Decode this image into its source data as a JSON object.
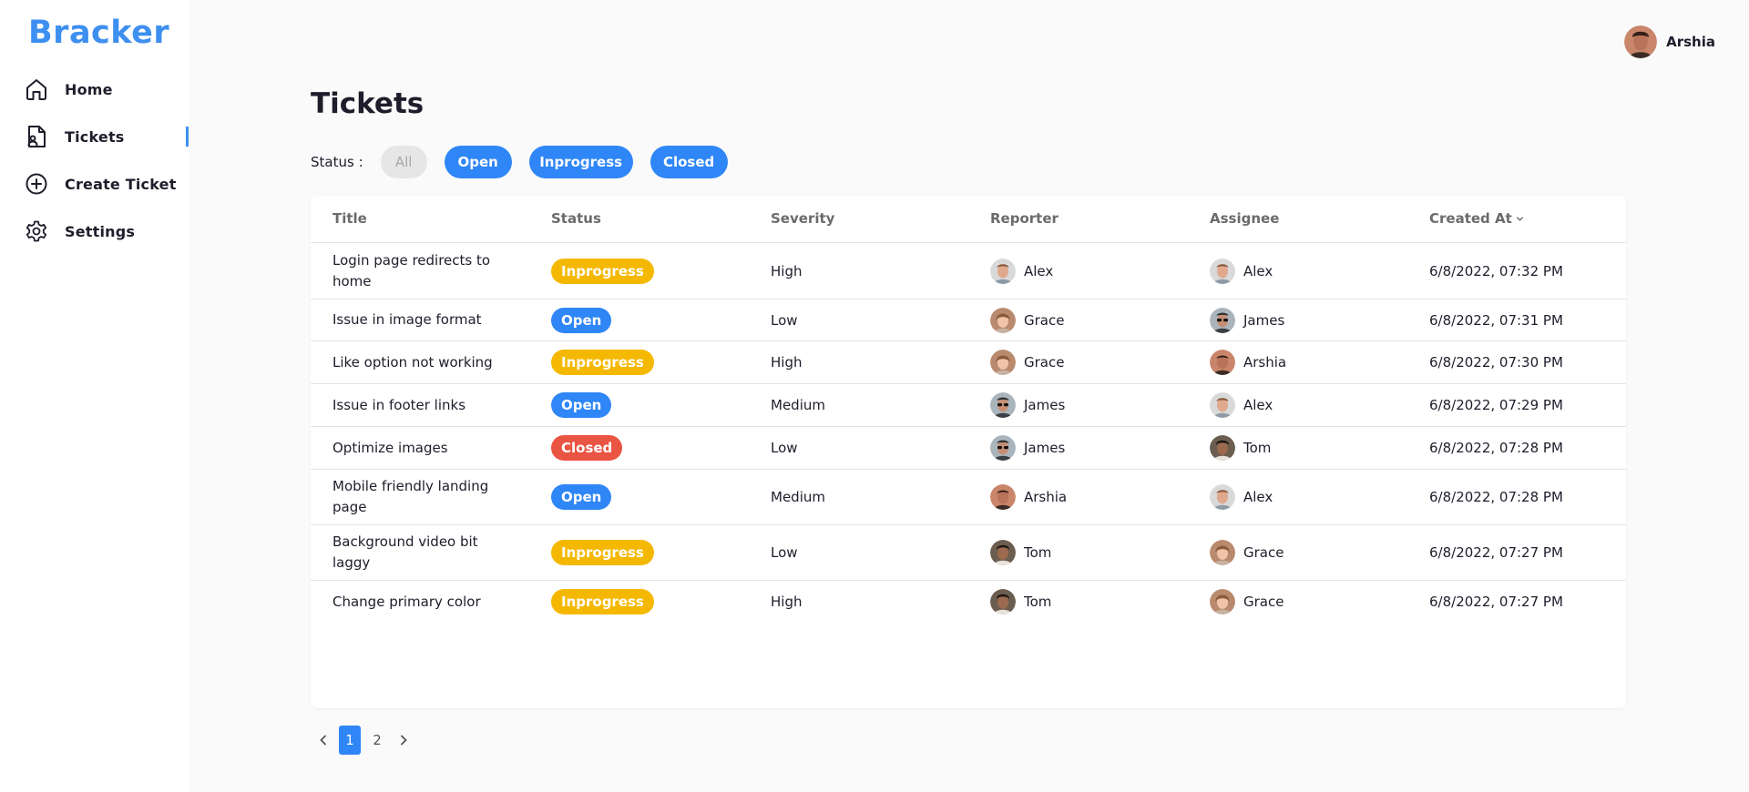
{
  "app": {
    "logo": "Bracker"
  },
  "sidebar": {
    "items": [
      {
        "label": "Home",
        "icon": "home-icon"
      },
      {
        "label": "Tickets",
        "icon": "ticket-document-icon",
        "active": true
      },
      {
        "label": "Create Ticket",
        "icon": "plus-circle-icon"
      },
      {
        "label": "Settings",
        "icon": "gear-icon"
      }
    ]
  },
  "header": {
    "user_name": "Arshia"
  },
  "page": {
    "title": "Tickets"
  },
  "filters": {
    "label": "Status :",
    "options": [
      {
        "label": "All",
        "state": "disabled"
      },
      {
        "label": "Open",
        "state": "selected"
      },
      {
        "label": "Inprogress",
        "state": "selected"
      },
      {
        "label": "Closed",
        "state": "selected"
      }
    ]
  },
  "table": {
    "columns": [
      "Title",
      "Status",
      "Severity",
      "Reporter",
      "Assignee",
      "Created At"
    ],
    "sort_column": "Created At",
    "rows": [
      {
        "title": "Login page redirects to home",
        "status": "Inprogress",
        "severity": "High",
        "reporter": "Alex",
        "assignee": "Alex",
        "created_at": "6/8/2022, 07:32 PM"
      },
      {
        "title": "Issue in image format",
        "status": "Open",
        "severity": "Low",
        "reporter": "Grace",
        "assignee": "James",
        "created_at": "6/8/2022, 07:31 PM"
      },
      {
        "title": "Like option not working",
        "status": "Inprogress",
        "severity": "High",
        "reporter": "Grace",
        "assignee": "Arshia",
        "created_at": "6/8/2022, 07:30 PM"
      },
      {
        "title": "Issue in footer links",
        "status": "Open",
        "severity": "Medium",
        "reporter": "James",
        "assignee": "Alex",
        "created_at": "6/8/2022, 07:29 PM"
      },
      {
        "title": "Optimize images",
        "status": "Closed",
        "severity": "Low",
        "reporter": "James",
        "assignee": "Tom",
        "created_at": "6/8/2022, 07:28 PM"
      },
      {
        "title": "Mobile friendly landing page",
        "status": "Open",
        "severity": "Medium",
        "reporter": "Arshia",
        "assignee": "Alex",
        "created_at": "6/8/2022, 07:28 PM"
      },
      {
        "title": "Background video bit laggy",
        "status": "Inprogress",
        "severity": "Low",
        "reporter": "Tom",
        "assignee": "Grace",
        "created_at": "6/8/2022, 07:27 PM"
      },
      {
        "title": "Change primary color",
        "status": "Inprogress",
        "severity": "High",
        "reporter": "Tom",
        "assignee": "Grace",
        "created_at": "6/8/2022, 07:27 PM"
      }
    ]
  },
  "pagination": {
    "pages": [
      "1",
      "2"
    ],
    "current": "1"
  },
  "colors": {
    "brand": "#3d8ff0",
    "open": "#2f86f6",
    "inprogress": "#f5b800",
    "closed": "#ea5442"
  }
}
